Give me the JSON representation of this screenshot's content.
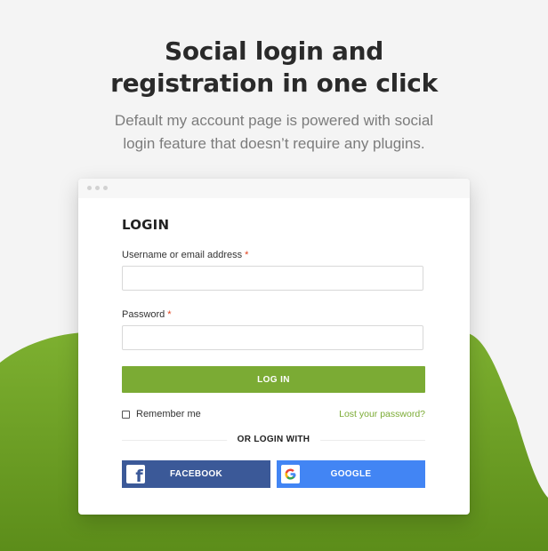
{
  "headline": {
    "line1": "Social login and",
    "line2": "registration in one click"
  },
  "subtitle": {
    "line1": "Default my account page is powered with social",
    "line2": "login feature that doesn’t require any plugins."
  },
  "login_form": {
    "title": "LOGIN",
    "username_label": "Username or email address",
    "password_label": "Password",
    "required_mark": "*",
    "username_value": "",
    "password_value": "",
    "login_button": "LOG IN",
    "remember_me": "Remember me",
    "remember_checked": false,
    "lost_password": "Lost your password?",
    "or_login_with": "OR LOGIN WITH",
    "facebook_button": "FACEBOOK",
    "google_button": "GOOGLE",
    "facebook_icon": "facebook-icon",
    "google_icon": "google-icon"
  },
  "colors": {
    "accent_green": "#7bab34",
    "facebook_blue": "#3b5998",
    "google_blue": "#4285f4",
    "headline": "#2a2a2a",
    "subtitle": "#7c7c7c",
    "required": "#e2401c"
  }
}
